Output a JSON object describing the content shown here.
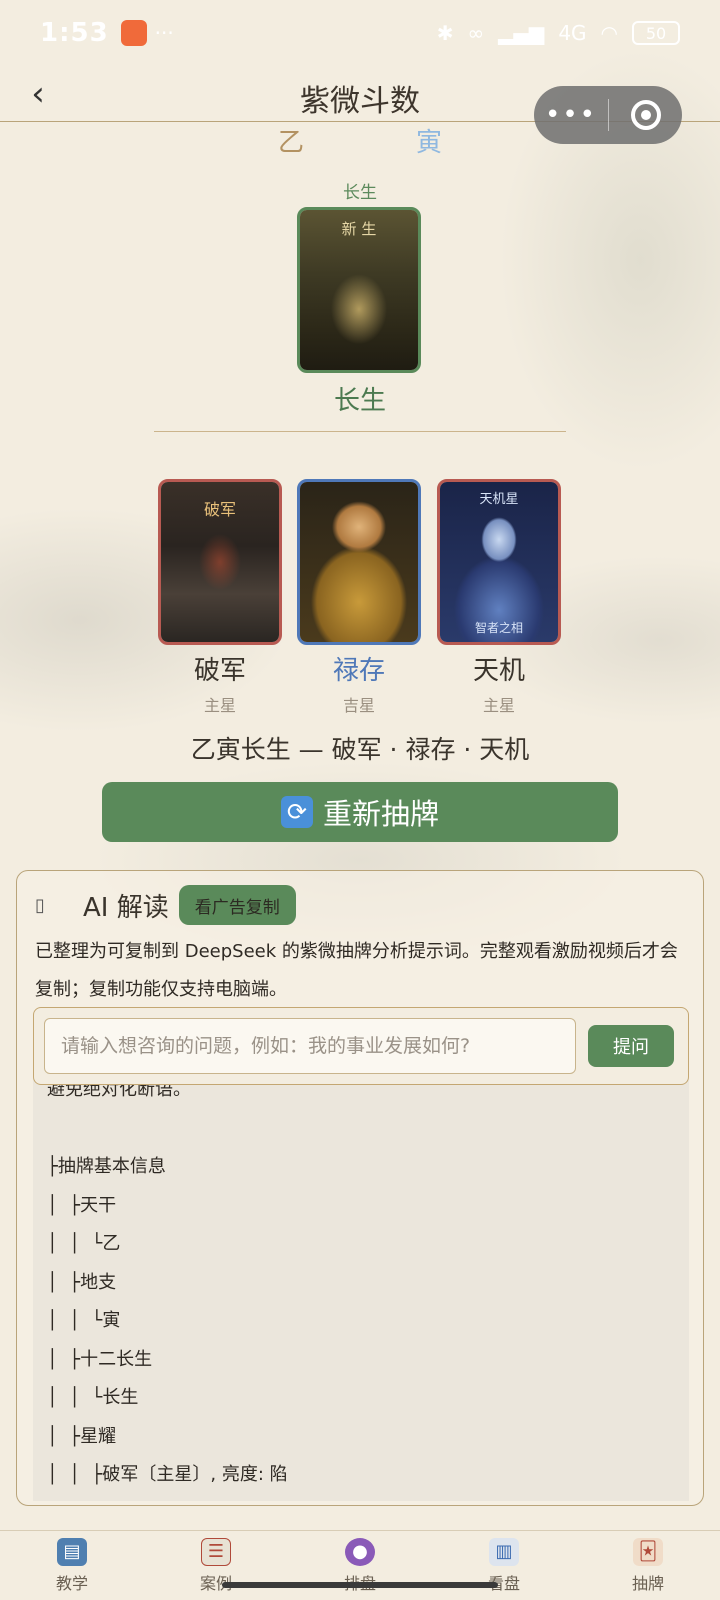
{
  "status_bar": {
    "time": "1:53",
    "dots": "···",
    "network": "4G",
    "battery": "50"
  },
  "header": {
    "title": "紫微斗数",
    "back_label": "‹"
  },
  "capsule": {
    "more_label": "•••"
  },
  "stem_branch": {
    "stem": "乙",
    "branch": "寅"
  },
  "main_card": {
    "top_label": "长生",
    "art_caption": "新 生",
    "name": "长生"
  },
  "stars": [
    {
      "name": "破军",
      "type": "主星",
      "art_caption": "破军"
    },
    {
      "name": "禄存",
      "type": "吉星"
    },
    {
      "name": "天机",
      "type": "主星",
      "art_caption": "天机星",
      "art_caption2": "智者之相"
    }
  ],
  "summary": "乙寅长生 — 破军 · 禄存 · 天机",
  "redraw_button": {
    "label": "重新抽牌",
    "icon": "refresh-icon"
  },
  "ai_panel": {
    "title": "AI 解读",
    "ad_copy_label": "看广告复制",
    "description": "已整理为可复制到 DeepSeek 的紫微抽牌分析提示词。完整观看激励视频后才会复制；复制功能仅支持电脑端。",
    "input_placeholder": "请输入想咨询的问题，例如：我的事业发展如何?",
    "ask_label": "提问",
    "analysis_lines": [
      "避免绝对化断语。",
      "",
      "├抽牌基本信息",
      "│  ├天干",
      "│  │  └乙",
      "│  ├地支",
      "│  │  └寅",
      "│  ├十二长生",
      "│  │  └长生",
      "│  ├星耀",
      "│  │  ├破军〔主星〕, 亮度: 陷"
    ]
  },
  "tabbar": [
    {
      "label": "教学",
      "icon": "book-icon"
    },
    {
      "label": "案例",
      "icon": "clipboard-icon"
    },
    {
      "label": "排盘",
      "icon": "crystal-ball-icon"
    },
    {
      "label": "看盘",
      "icon": "chart-icon"
    },
    {
      "label": "抽牌",
      "icon": "joker-card-icon"
    }
  ],
  "colors": {
    "accent_green": "#5a8a5a",
    "star_blue": "#4f78b8",
    "card_red": "#b85a52",
    "background": "#f3ede0"
  }
}
